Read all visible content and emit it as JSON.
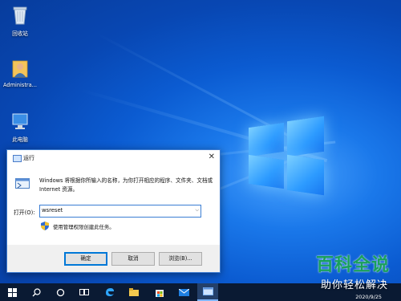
{
  "desktop": {
    "icons": [
      {
        "label": "回收站",
        "icon": "recycle-bin-icon"
      },
      {
        "label": "Administra...",
        "icon": "user-folder-icon"
      },
      {
        "label": "此电脑",
        "icon": "computer-icon"
      }
    ]
  },
  "run_dialog": {
    "title": "运行",
    "description": "Windows 将根据你所输入的名称，为你打开相应的程序、文件夹、文档或 Internet 资源。",
    "open_label": "打开(O):",
    "command_value": "wsreset",
    "admin_note": "使用管理权限创建此任务。",
    "ok_label": "确定",
    "cancel_label": "取消",
    "browse_label": "浏览(B)..."
  },
  "taskbar": {
    "items": [
      "windows-start-icon",
      "search-icon",
      "cortana-icon",
      "task-view-icon",
      "edge-icon",
      "file-explorer-icon",
      "store-icon",
      "mail-icon",
      "run-icon"
    ],
    "date": "2020/9/25"
  },
  "watermark": {
    "title": "百科全说",
    "subtitle": "助你轻松解决"
  },
  "colors": {
    "desktop_blue": "#0b5bd1",
    "accent": "#0078d7",
    "taskbar": "#0a1a33",
    "watermark_green": "#18a05b"
  }
}
